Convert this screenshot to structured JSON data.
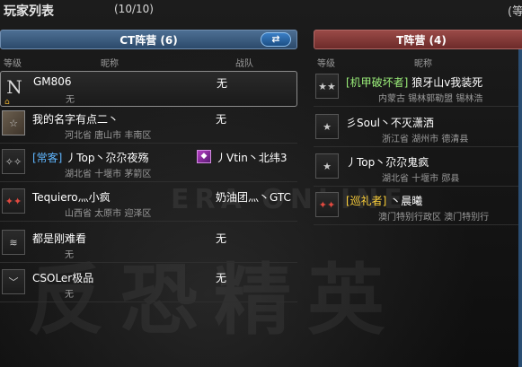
{
  "header": {
    "title": "玩家列表",
    "count": "(10/10)",
    "corner": "(等"
  },
  "watermark": {
    "main": "反恐精英",
    "sub": "ERA  ONLINE"
  },
  "ct": {
    "team_label": "CT阵营 (6)",
    "swap_icon": "swap-arrows-icon",
    "columns": {
      "rank": "等级",
      "nick": "昵称",
      "clan": "战队"
    },
    "rows": [
      {
        "rank_text": "N",
        "rank_icon": "letter-n-rank-icon",
        "nick": "GM806",
        "clan": "无",
        "loc": "无",
        "highlight": true
      },
      {
        "rank_text": "☆",
        "rank_icon": "avatar-photo-icon",
        "nick": "我的名字有点二丶",
        "clan": "无",
        "loc": "河北省 唐山市 丰南区"
      },
      {
        "rank_text": "✧✧",
        "rank_icon": "star-rank-icon",
        "tag": "[常客]",
        "nick": "丿Top丶尕尕夜殇",
        "clan": "丿Vtin丶北纬3",
        "clan_icon": "clan-emblem-icon",
        "loc": "湖北省 十堰市 茅箭区"
      },
      {
        "rank_text": "✦✦",
        "rank_icon": "red-star-rank-icon",
        "nick": "Tequiero灬小疯",
        "clan": "奶油团灬丶GTC",
        "loc": "山西省 太原市 迎泽区"
      },
      {
        "rank_text": "≋",
        "rank_icon": "chevron-rank-icon",
        "nick": "都是刚难看",
        "clan": "无",
        "loc": "无"
      },
      {
        "rank_text": "﹀",
        "rank_icon": "stripe-rank-icon",
        "nick": "CSOLer极品",
        "clan": "无",
        "loc": "无"
      }
    ]
  },
  "t": {
    "team_label": "T阵营 (4)",
    "columns": {
      "rank": "等级",
      "nick": "昵称"
    },
    "rows": [
      {
        "rank_text": "★★",
        "rank_icon": "double-star-rank-icon",
        "tag": "[机甲破坏者]",
        "nick": "狼牙山v我装死",
        "loc": "内蒙古 锡林郭勒盟 锡林浩"
      },
      {
        "rank_text": "★",
        "rank_icon": "star-rank-icon",
        "nick": "彡Soul丶不灭潇洒",
        "loc": "浙江省 湖州市 德清县"
      },
      {
        "rank_text": "★",
        "rank_icon": "star-rank-icon",
        "nick": "丿Top丶尕尕鬼疯",
        "loc": "湖北省 十堰市 郧县"
      },
      {
        "rank_text": "✦✦",
        "rank_icon": "red-star-rank-icon",
        "tag": "[巡礼者]",
        "nick": "丶晨曦",
        "loc": "澳门特别行政区 澳门特别行"
      }
    ]
  },
  "colors": {
    "ct_accent": "#2c4a6b",
    "t_accent": "#6d2b2a",
    "tag_cyan": "#5fb6ff",
    "tag_green": "#9cf07a",
    "tag_yellow": "#ffd23c"
  }
}
